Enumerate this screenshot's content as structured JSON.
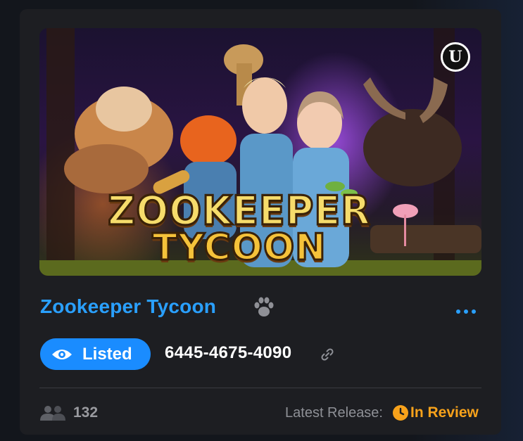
{
  "card": {
    "title": "Zookeeper Tycoon",
    "thumbnail": {
      "logo_line1": "ZOOKEEPER",
      "logo_line2": "TYCOON",
      "engine_badge_icon": "unreal-engine-logo-icon"
    },
    "title_icon": "paw-icon",
    "menu_icon": "more-horizontal-icon",
    "status": {
      "label": "Listed",
      "icon": "eye-icon"
    },
    "island_code": "6445-4675-4090",
    "copy_link_icon": "link-icon",
    "players": {
      "icon": "users-icon",
      "count": "132"
    },
    "release": {
      "label": "Latest Release:",
      "status": "In Review",
      "icon": "clock-icon"
    }
  },
  "colors": {
    "card_bg": "#1d1e22",
    "accent_blue": "#2aa0ff",
    "pill_blue": "#1a8cff",
    "review_orange": "#f7a21b",
    "muted_text": "#8e9096"
  }
}
